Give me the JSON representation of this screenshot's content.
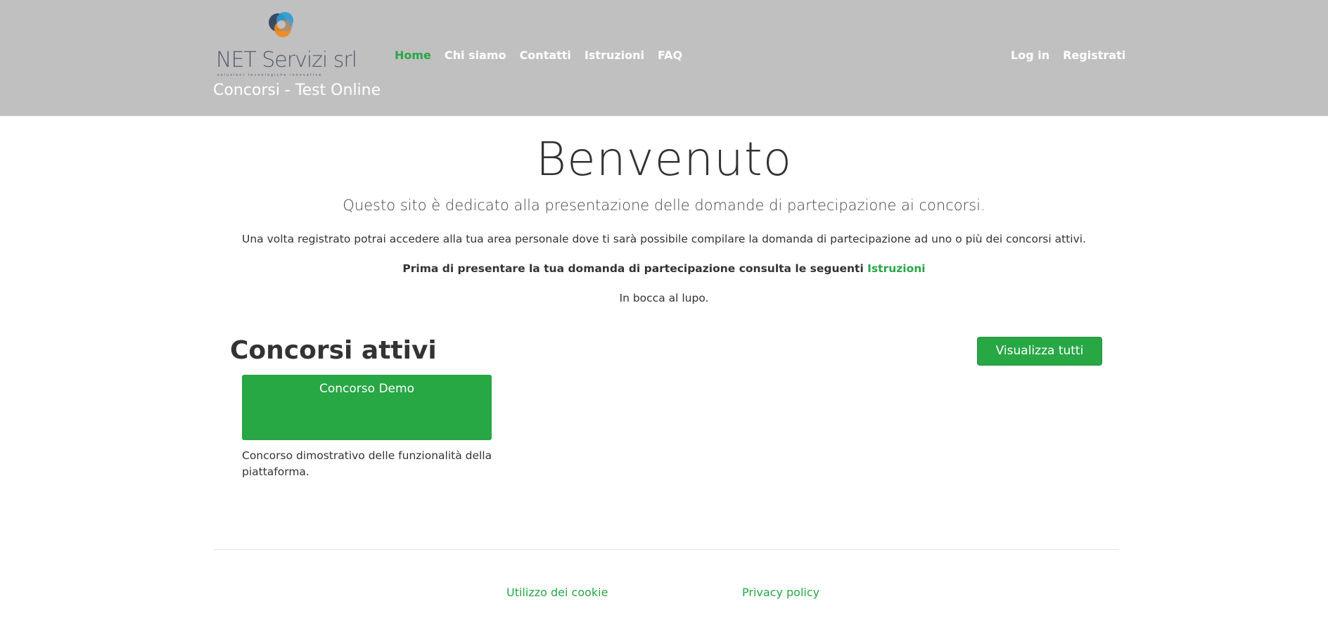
{
  "header": {
    "logo": {
      "name": "NET Servizi srl",
      "tagline": "soluzioni tecnologiche innovative"
    },
    "site_title": "Concorsi - Test Online",
    "nav": [
      {
        "label": "Home",
        "active": true
      },
      {
        "label": "Chi siamo",
        "active": false
      },
      {
        "label": "Contatti",
        "active": false
      },
      {
        "label": "Istruzioni",
        "active": false
      },
      {
        "label": "FAQ",
        "active": false
      }
    ],
    "auth": {
      "login": "Log in",
      "register": "Registrati"
    }
  },
  "main": {
    "title": "Benvenuto",
    "lead": "Questo sito è dedicato alla presentazione delle domande di partecipazione ai concorsi.",
    "paragraph1": "Una volta registrato potrai accedere alla tua area personale dove ti sarà possibile compilare la domanda di partecipazione ad uno o più dei concorsi attivi.",
    "paragraph2_text": "Prima di presentare la tua domanda di partecipazione consulta le seguenti ",
    "paragraph2_link": "Istruzioni",
    "paragraph3": "In bocca al lupo.",
    "active_section": {
      "title": "Concorsi attivi",
      "view_all": "Visualizza tutti",
      "cards": [
        {
          "title": "Concorso Demo",
          "description": "Concorso dimostrativo delle funzionalità della piattaforma."
        }
      ]
    }
  },
  "footer": {
    "cookie": "Utilizzo dei cookie",
    "privacy": "Privacy policy"
  },
  "colors": {
    "accent": "#28a745",
    "header_bg": "#c0c0c0",
    "text": "#333333"
  }
}
